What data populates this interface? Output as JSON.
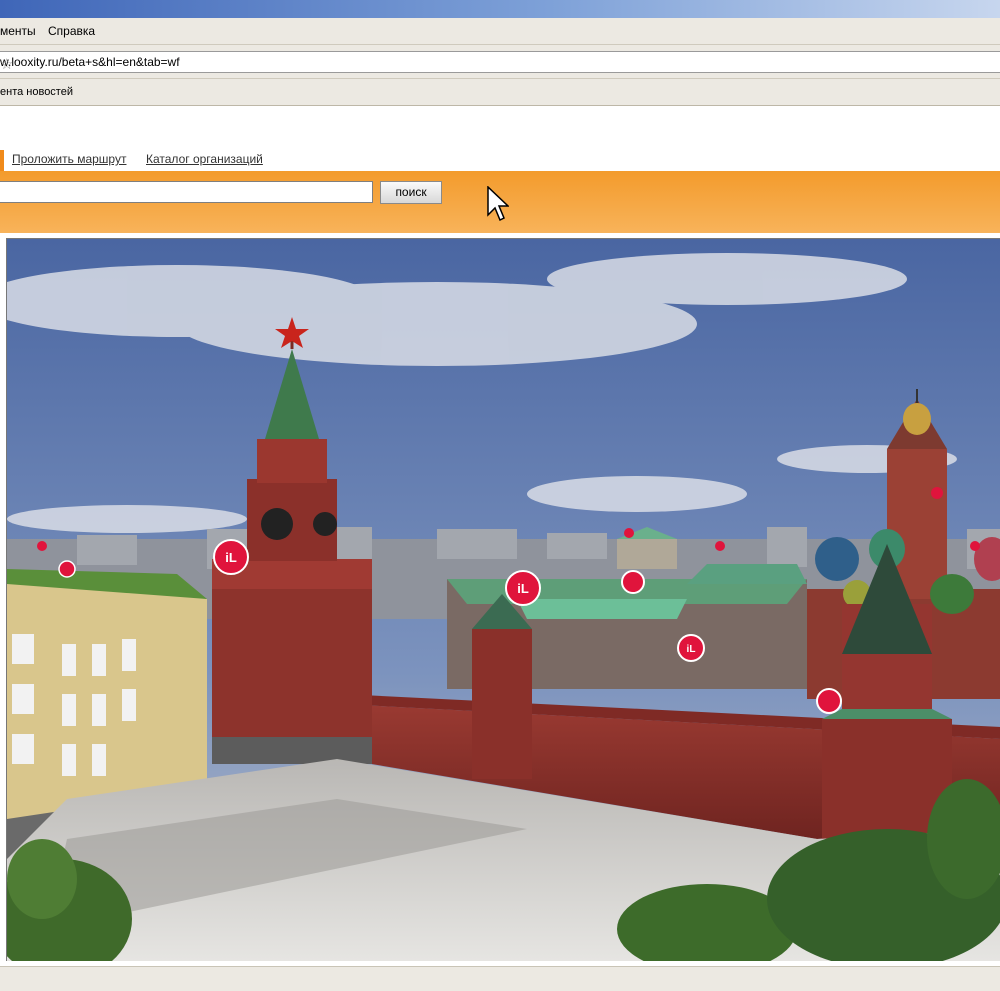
{
  "menu": {
    "items": [
      "менты",
      "Справка"
    ]
  },
  "address_bar": {
    "url": "w.looxity.ru/beta+s&hl=en&tab=wf"
  },
  "bookmarks": {
    "item": "ента новостей"
  },
  "nav": {
    "route_link": "Проложить маршрут",
    "catalog_link": "Каталог организаций"
  },
  "search": {
    "button_label": "поиск",
    "value": ""
  },
  "viewer": {
    "marker_label": "iL",
    "colors": {
      "marker": "#e0143c",
      "wall": "#8f2f2a",
      "roof": "#4f9a72",
      "sky": "#4e6aa4"
    }
  },
  "colors": {
    "accent": "#f39b2c",
    "chrome": "#ece9e2"
  }
}
